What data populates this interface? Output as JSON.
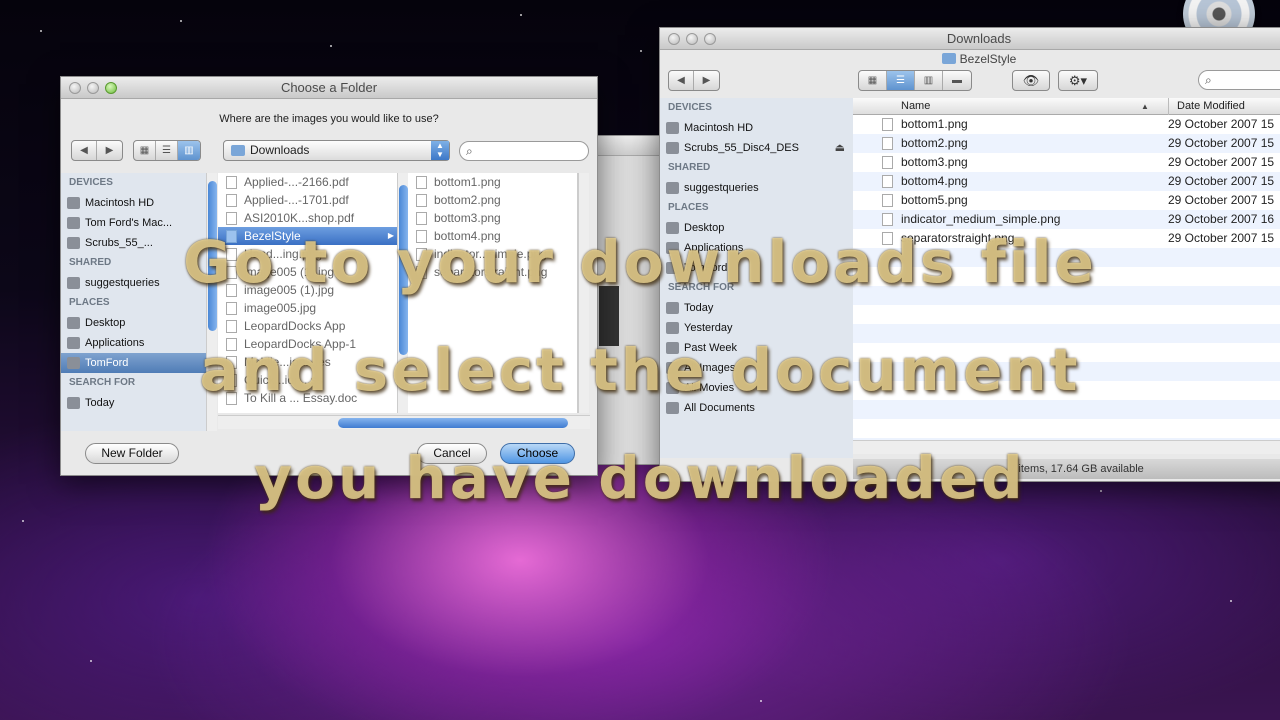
{
  "dialog": {
    "title": "Choose a Folder",
    "prompt": "Where are the images you would like to use?",
    "location": "Downloads",
    "sidebar": [
      {
        "type": "head",
        "label": "DEVICES"
      },
      {
        "type": "item",
        "label": "Macintosh HD",
        "icon": "hard-drive-icon"
      },
      {
        "type": "item",
        "label": "Tom Ford's Mac...",
        "icon": "computer-icon"
      },
      {
        "type": "item",
        "label": "Scrubs_55_...",
        "icon": "disc-icon"
      },
      {
        "type": "head",
        "label": "SHARED"
      },
      {
        "type": "item",
        "label": "suggestqueries",
        "icon": "network-computer-icon"
      },
      {
        "type": "head",
        "label": "PLACES"
      },
      {
        "type": "item",
        "label": "Desktop",
        "icon": "desktop-icon"
      },
      {
        "type": "item",
        "label": "Applications",
        "icon": "applications-icon"
      },
      {
        "type": "item",
        "label": "TomFord",
        "icon": "home-icon",
        "selected": true
      },
      {
        "type": "head",
        "label": "SEARCH FOR"
      },
      {
        "type": "item",
        "label": "Today",
        "icon": "clock-icon"
      }
    ],
    "column1": [
      {
        "label": "Applied-...-2166.pdf"
      },
      {
        "label": "Applied-...-1701.pdf"
      },
      {
        "label": "ASI2010K...shop.pdf"
      },
      {
        "label": "BezelStyle",
        "selected": true,
        "folder": true
      },
      {
        "label": "Hand...ing.png"
      },
      {
        "label": "image005 (1).jpg"
      },
      {
        "label": "image005 (1).jpg"
      },
      {
        "label": "image005.jpg"
      },
      {
        "label": "LeopardDocks App"
      },
      {
        "label": "LeopardDocks App-1"
      },
      {
        "label": "Mobile...ion...ies"
      },
      {
        "label": "Quick...ion...ss"
      },
      {
        "label": "To Kill a ... Essay.doc"
      }
    ],
    "column2": [
      {
        "label": "bottom1.png"
      },
      {
        "label": "bottom2.png"
      },
      {
        "label": "bottom3.png"
      },
      {
        "label": "bottom4.png"
      },
      {
        "label": "indicator...simple.png"
      },
      {
        "label": "separatorstraight.png"
      }
    ],
    "new_folder": "New Folder",
    "cancel": "Cancel",
    "choose": "Choose"
  },
  "finder": {
    "title": "Downloads",
    "subtitle": "BezelStyle",
    "sidebar": [
      {
        "type": "head",
        "label": "DEVICES"
      },
      {
        "type": "item",
        "label": "Macintosh HD",
        "icon": "hard-drive-icon"
      },
      {
        "type": "item",
        "label": "Scrubs_55_Disc4_DES",
        "icon": "disc-icon",
        "eject": true
      },
      {
        "type": "head",
        "label": "SHARED"
      },
      {
        "type": "item",
        "label": "suggestqueries",
        "icon": "network-computer-icon"
      },
      {
        "type": "head",
        "label": "PLACES"
      },
      {
        "type": "item",
        "label": "Desktop",
        "icon": "desktop-icon"
      },
      {
        "type": "item",
        "label": "Applications",
        "icon": "applications-icon"
      },
      {
        "type": "item",
        "label": "TomFord",
        "icon": "home-icon"
      },
      {
        "type": "head",
        "label": "SEARCH FOR"
      },
      {
        "type": "item",
        "label": "Today",
        "icon": "clock-icon"
      },
      {
        "type": "item",
        "label": "Yesterday",
        "icon": "clock-icon"
      },
      {
        "type": "item",
        "label": "Past Week",
        "icon": "clock-icon"
      },
      {
        "type": "item",
        "label": "All Images",
        "icon": "smart-folder-icon"
      },
      {
        "type": "item",
        "label": "All Movies",
        "icon": "smart-folder-icon"
      },
      {
        "type": "item",
        "label": "All Documents",
        "icon": "smart-folder-icon"
      }
    ],
    "columns": {
      "name": "Name",
      "date": "Date Modified"
    },
    "files": [
      {
        "name": "bottom1.png",
        "date": "29 October 2007 15"
      },
      {
        "name": "bottom2.png",
        "date": "29 October 2007 15"
      },
      {
        "name": "bottom3.png",
        "date": "29 October 2007 15"
      },
      {
        "name": "bottom4.png",
        "date": "29 October 2007 15"
      },
      {
        "name": "bottom5.png",
        "date": "29 October 2007 15"
      },
      {
        "name": "indicator_medium_simple.png",
        "date": "29 October 2007 16"
      },
      {
        "name": "separatorstraight.png",
        "date": "29 October 2007 15"
      }
    ],
    "status": "7 items, 17.64 GB available"
  },
  "caption": [
    "Go to your downloads file",
    "and select the document",
    "you have downloaded"
  ]
}
